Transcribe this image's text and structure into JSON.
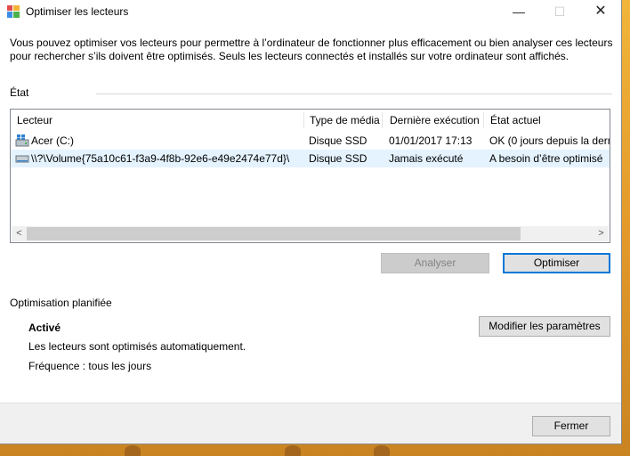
{
  "window": {
    "title": "Optimiser les lecteurs",
    "minimize_glyph": "—",
    "maximize_glyph": "☐",
    "close_glyph": "✕"
  },
  "description": "Vous pouvez optimiser vos lecteurs pour permettre à l’ordinateur de fonctionner plus efficacement ou bien analyser ces lecteurs pour rechercher s’ils doivent être optimisés. Seuls les lecteurs connectés et installés sur votre ordinateur sont affichés.",
  "status_group": {
    "label": "État"
  },
  "drive_list": {
    "columns": [
      "Lecteur",
      "Type de média",
      "Dernière exécution",
      "État actuel"
    ],
    "rows": [
      {
        "icon": "windows-drive-icon",
        "drive": "Acer (C:)",
        "media_type": "Disque SSD",
        "last_run": "01/01/2017 17:13",
        "current_state": "OK (0 jours depuis la dern"
      },
      {
        "icon": "volume-drive-icon",
        "drive": "\\\\?\\Volume{75a10c61-f3a9-4f8b-92e6-e49e2474e77d}\\",
        "media_type": "Disque SSD",
        "last_run": "Jamais exécuté",
        "current_state": "A besoin d’être optimisé",
        "selected": true
      }
    ],
    "scroll_left_glyph": "<",
    "scroll_right_glyph": ">"
  },
  "actions": {
    "analyze_label": "Analyser",
    "optimize_label": "Optimiser"
  },
  "scheduled": {
    "label": "Optimisation planifiée",
    "status": "Activé",
    "description": "Les lecteurs sont optimisés automatiquement.",
    "frequency": "Fréquence : tous les jours",
    "settings_button_label": "Modifier les paramètres"
  },
  "footer": {
    "close_label": "Fermer"
  },
  "colors": {
    "accent": "#0078d7",
    "selected_row": "#e5f3ff",
    "desktop": "#e39a2a"
  }
}
